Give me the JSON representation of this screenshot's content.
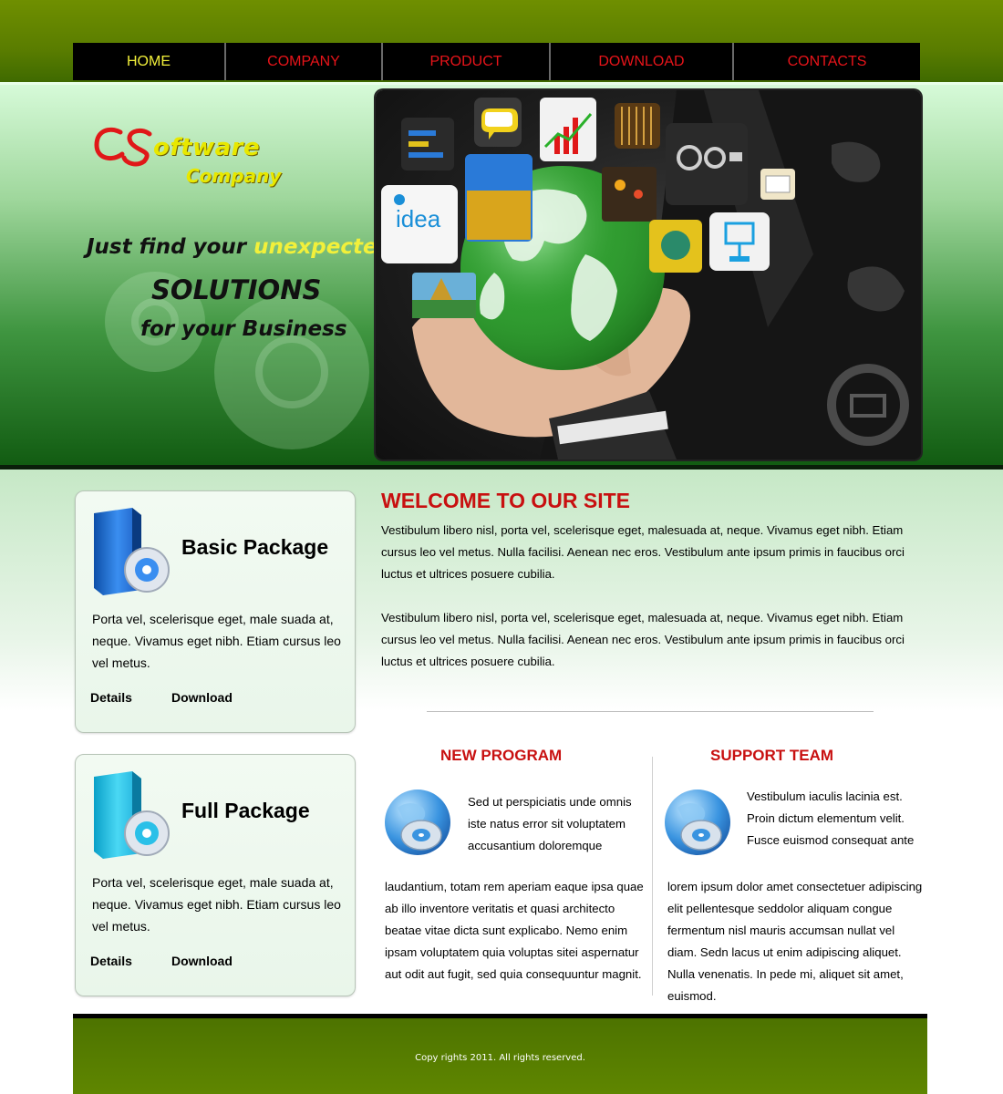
{
  "nav": {
    "items": [
      {
        "label": "HOME",
        "active": true
      },
      {
        "label": "COMPANY",
        "active": false
      },
      {
        "label": "PRODUCT",
        "active": false
      },
      {
        "label": "DOWNLOAD",
        "active": false
      },
      {
        "label": "CONTACTS",
        "active": false
      }
    ]
  },
  "hero": {
    "logo_word": "oftware",
    "logo_sub": "Company",
    "tagline_lead": "Just find your",
    "tagline_highlight": "unexpected",
    "tagline_big": "SOLUTIONS",
    "tagline_end": "for your Business",
    "image_tile_text": "idea"
  },
  "packages": [
    {
      "title": "Basic Package",
      "text": "Porta vel, scelerisque eget, male suada at, neque. Vivamus eget nibh. Etiam cursus leo vel metus.",
      "details_label": "Details",
      "download_label": "Download"
    },
    {
      "title": "Full Package",
      "text": "Porta vel, scelerisque eget, male suada at, neque. Vivamus eget nibh. Etiam cursus leo vel metus.",
      "details_label": "Details",
      "download_label": "Download"
    }
  ],
  "welcome": {
    "title": "WELCOME TO OUR SITE",
    "p1": "Vestibulum libero nisl, porta vel, scelerisque eget, malesuada at, neque. Vivamus eget nibh. Etiam cursus leo vel metus. Nulla facilisi. Aenean nec eros. Vestibulum ante ipsum primis in faucibus orci luctus et ultrices posuere cubilia.",
    "p2": "Vestibulum libero nisl, porta vel, scelerisque eget, malesuada at, neque. Vivamus eget nibh. Etiam cursus leo vel metus. Nulla facilisi. Aenean nec eros. Vestibulum ante ipsum primis in faucibus orci luctus et ultrices posuere cubilia."
  },
  "new_program": {
    "title": "NEW PROGRAM",
    "short": "Sed ut perspiciatis unde omnis iste natus error sit voluptatem accusantium doloremque",
    "long": "laudantium, totam rem aperiam eaque ipsa quae ab illo inventore veritatis et quasi architecto beatae vitae dicta sunt explicabo. Nemo enim ipsam voluptatem quia voluptas sitei aspernatur aut odit aut fugit, sed quia consequuntur magnit."
  },
  "support_team": {
    "title": "SUPPORT TEAM",
    "short": "Vestibulum iaculis lacinia est. Proin dictum elementum velit. Fusce euismod consequat ante",
    "long": "lorem ipsum dolor amet consectetuer adipiscing elit pellentesque seddolor aliquam congue fermentum nisl mauris accumsan nullat vel diam. Sedn lacus ut enim adipiscing aliquet. Nulla venenatis. In pede mi, aliquet sit amet, euismod."
  },
  "footer": {
    "text": "Copy rights 2011. All rights reserved."
  },
  "colors": {
    "nav_active": "#f2f03a",
    "nav_link": "#e8141a",
    "heading_red": "#c81010",
    "footer_green": "#5a7d00"
  }
}
